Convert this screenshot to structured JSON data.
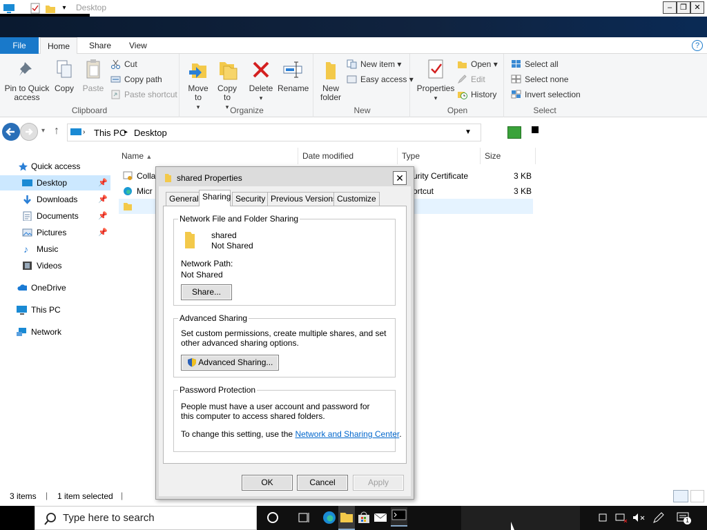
{
  "window": {
    "title": "Desktop"
  },
  "ribbon_tabs": [
    "File",
    "Home",
    "Share",
    "View"
  ],
  "ribbon": {
    "clipboard": {
      "group": "Clipboard",
      "pin": "Pin to Quick access",
      "copy": "Copy",
      "paste": "Paste",
      "cut": "Cut",
      "copy_path": "Copy path",
      "paste_shortcut": "Paste shortcut"
    },
    "organize": {
      "group": "Organize",
      "move_to": "Move to",
      "copy_to": "Copy to",
      "delete": "Delete",
      "rename": "Rename"
    },
    "new": {
      "group": "New",
      "new_folder": "New folder",
      "new_item": "New item",
      "easy_access": "Easy access"
    },
    "open": {
      "group": "Open",
      "properties": "Properties",
      "open": "Open",
      "edit": "Edit",
      "history": "History"
    },
    "select": {
      "group": "Select",
      "select_all": "Select all",
      "select_none": "Select none",
      "invert": "Invert selection"
    }
  },
  "address": {
    "crumbs": [
      "This PC",
      "Desktop"
    ]
  },
  "nav": {
    "quick_access": "Quick access",
    "items": [
      "Desktop",
      "Downloads",
      "Documents",
      "Pictures",
      "Music",
      "Videos"
    ],
    "onedrive": "OneDrive",
    "thispc": "This PC",
    "network": "Network"
  },
  "columns": [
    "Name",
    "Date modified",
    "Type",
    "Size"
  ],
  "files": [
    {
      "name": "Colla",
      "type": "urity Certificate",
      "size": "3 KB"
    },
    {
      "name": "Micr",
      "type": "ortcut",
      "size": "3 KB"
    },
    {
      "name": "",
      "type": "",
      "size": ""
    }
  ],
  "status": {
    "count": "3 items",
    "selected": "1 item selected"
  },
  "dialog": {
    "title": "shared Properties",
    "tabs": [
      "General",
      "Sharing",
      "Security",
      "Previous Versions",
      "Customize"
    ],
    "active_tab": "Sharing",
    "nffs": {
      "label": "Network File and Folder Sharing",
      "folder_name": "shared",
      "folder_state": "Not Shared",
      "path_label": "Network Path:",
      "path_value": "Not Shared",
      "share_btn": "Share..."
    },
    "advanced": {
      "label": "Advanced Sharing",
      "desc": "Set custom permissions, create multiple shares, and set other advanced sharing options.",
      "btn": "Advanced Sharing..."
    },
    "password": {
      "label": "Password Protection",
      "desc": "People must have a user account and password for this computer to access shared folders.",
      "change_prefix": "To change this setting, use the ",
      "link": "Network and Sharing Center",
      "change_suffix": "."
    },
    "ok": "OK",
    "cancel": "Cancel",
    "apply": "Apply"
  },
  "taskbar": {
    "search_placeholder": "Type here to search",
    "notification_count": "1"
  }
}
